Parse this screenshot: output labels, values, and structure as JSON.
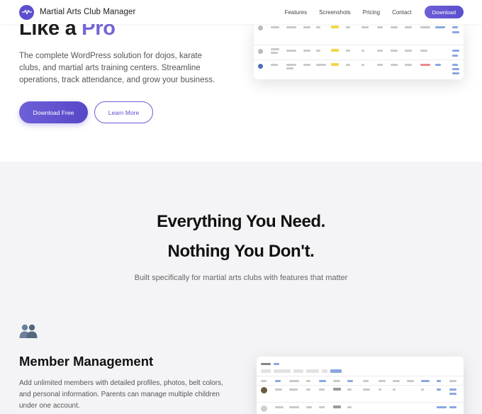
{
  "nav": {
    "brand": "Martial Arts Club Manager",
    "links": [
      "Features",
      "Screenshots",
      "Pricing",
      "Contact"
    ],
    "download_label": "Download"
  },
  "hero": {
    "title_main": "Like a ",
    "title_accent": "Pro",
    "description": "The complete WordPress solution for dojos, karate clubs, and martial arts training centers. Streamline operations, track attendance, and grow your business.",
    "primary_button": "Download Free",
    "secondary_button": "Learn More"
  },
  "features": {
    "title_line1": "Everything You Need.",
    "title_line2": "Nothing You Don't.",
    "subtitle": "Built specifically for martial arts clubs with features that matter",
    "items": [
      {
        "icon": "members-icon",
        "title": "Member Management",
        "description": "Add unlimited members with detailed profiles, photos, belt colors, and personal information. Parents can manage multiple children under one account."
      }
    ]
  },
  "colors": {
    "accent": "#5b4fcf",
    "accent_light": "#7465d6",
    "section_bg": "#f4f4f6"
  }
}
